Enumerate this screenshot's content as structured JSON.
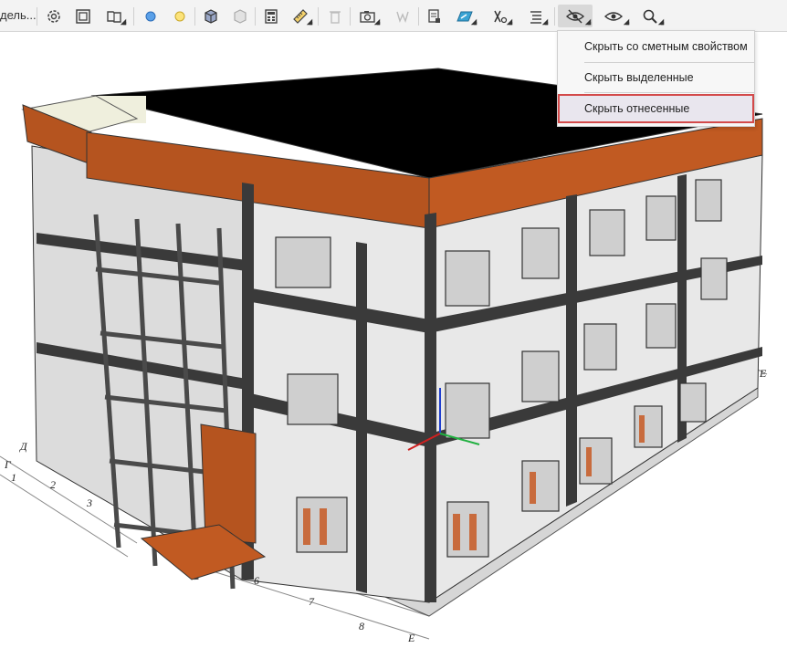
{
  "toolbar": {
    "truncated_label": "дель...",
    "buttons": [
      {
        "name": "settings-icon"
      },
      {
        "name": "frame-icon"
      },
      {
        "name": "book-icon"
      },
      {
        "name": "blue-dot-icon"
      },
      {
        "name": "yellow-dot-icon"
      },
      {
        "name": "cube-icon"
      },
      {
        "name": "cube-disabled-icon"
      },
      {
        "name": "calculator-icon"
      },
      {
        "name": "ruler-icon"
      },
      {
        "name": "trash-icon"
      },
      {
        "name": "camera-icon"
      },
      {
        "name": "w-disabled-icon"
      },
      {
        "name": "report-icon"
      },
      {
        "name": "layer-icon"
      },
      {
        "name": "axes-icon"
      },
      {
        "name": "list-icon"
      },
      {
        "name": "eye-hide-icon"
      },
      {
        "name": "eye-show-icon"
      },
      {
        "name": "zoom-icon"
      }
    ]
  },
  "hide_menu": {
    "items": [
      {
        "label": "Скрыть со сметным свойством"
      },
      {
        "label": "Скрыть выделенные"
      },
      {
        "label": "Скрыть отнесенные"
      }
    ],
    "highlighted_index": 2
  },
  "grid_axes": {
    "labels": [
      "Д",
      "Г",
      "1",
      "2",
      "3",
      "6",
      "7",
      "8",
      "Е",
      "Е"
    ]
  },
  "colors": {
    "accent_highlight": "#d34a4a",
    "roof_orange": "#b5541f",
    "wall_panel": "#e6e6e6",
    "frame_dark": "#3a3a3a"
  }
}
